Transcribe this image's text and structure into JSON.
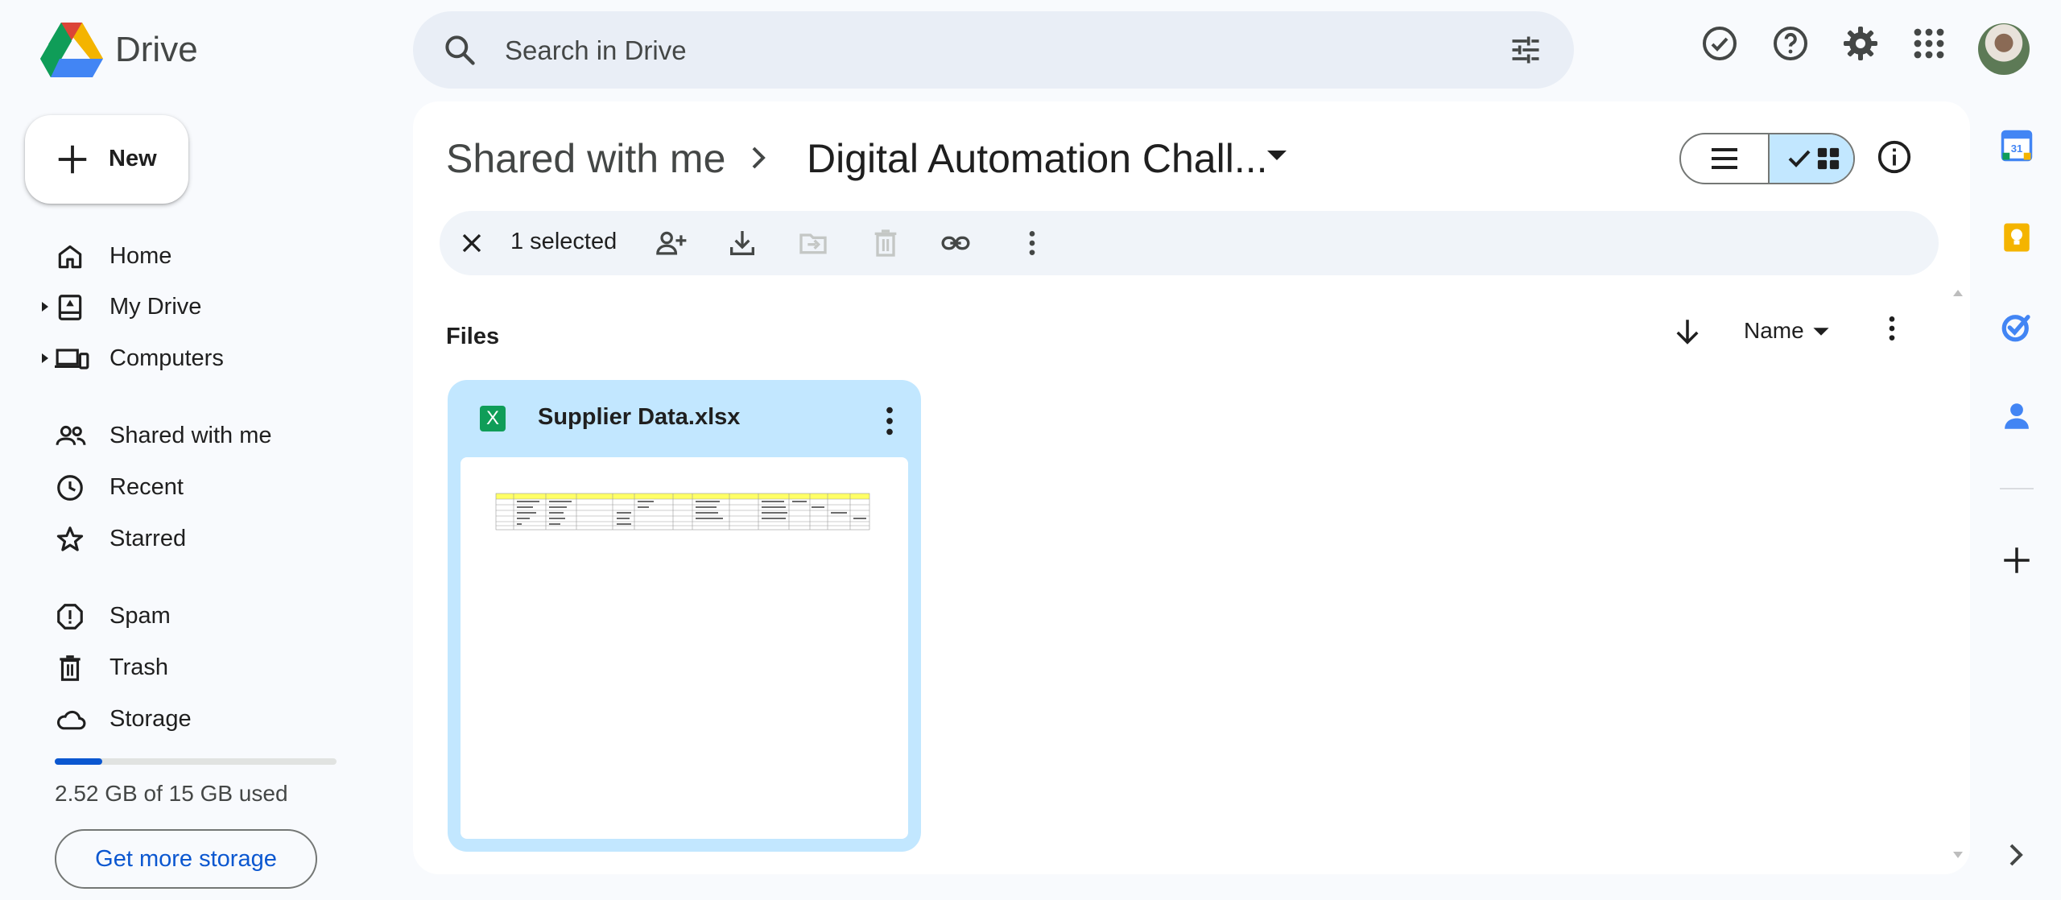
{
  "app": {
    "name": "Drive",
    "logo_icon": "google-drive-logo",
    "colors": {
      "blue": "#4285f4",
      "green": "#0f9d58",
      "yellow": "#f4b400",
      "red": "#db4437",
      "accent": "#0b57d0",
      "selected": "#c2e7ff"
    }
  },
  "search": {
    "placeholder": "Search in Drive",
    "filter_icon": "tune-icon"
  },
  "topbar_icons": [
    "ready-for-offline-icon",
    "help-icon",
    "settings-icon",
    "apps-grid-icon",
    "account-avatar"
  ],
  "sidebar": {
    "new_label": "New",
    "items": [
      {
        "label": "Home",
        "icon": "home-icon"
      },
      {
        "label": "My Drive",
        "icon": "my-drive-icon",
        "expandable": true
      },
      {
        "label": "Computers",
        "icon": "computers-icon",
        "expandable": true
      },
      {
        "label": "Shared with me",
        "icon": "people-icon"
      },
      {
        "label": "Recent",
        "icon": "clock-icon"
      },
      {
        "label": "Starred",
        "icon": "star-icon"
      },
      {
        "label": "Spam",
        "icon": "spam-icon"
      },
      {
        "label": "Trash",
        "icon": "trash-icon"
      },
      {
        "label": "Storage",
        "icon": "cloud-icon"
      }
    ],
    "storage": {
      "used_text": "2.52 GB of 15 GB used",
      "used_fraction": 0.168,
      "button_label": "Get more storage"
    }
  },
  "breadcrumb": {
    "parent": "Shared with me",
    "current": "Digital Automation Chall..."
  },
  "view": {
    "mode": "grid"
  },
  "selection": {
    "count_text": "1 selected",
    "actions": [
      "close-icon",
      "share-icon",
      "download-icon",
      "move-icon",
      "trash-icon",
      "link-icon",
      "more-vert-icon"
    ]
  },
  "files_section": {
    "heading": "Files",
    "sort_label": "Name",
    "sort_direction": "descending"
  },
  "files": [
    {
      "name": "Supplier Data.xlsx",
      "type_icon_text": "X",
      "selected": true
    }
  ],
  "right_rail": [
    "calendar-icon",
    "keep-icon",
    "tasks-icon",
    "contacts-icon",
    "add-icon"
  ],
  "calendar_day": "31"
}
